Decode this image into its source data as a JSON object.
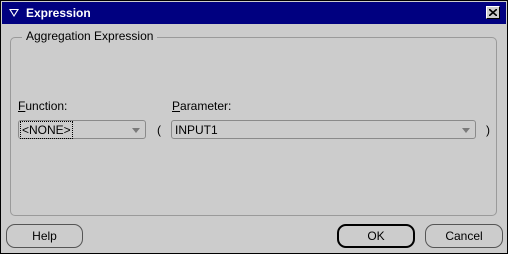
{
  "window": {
    "title": "Expression"
  },
  "group": {
    "title": "Aggregation Expression"
  },
  "function": {
    "label": "Function:",
    "value": "<NONE>"
  },
  "parameter": {
    "label": "Parameter:",
    "value": "INPUT1"
  },
  "parens": {
    "open": "(",
    "close": ")"
  },
  "buttons": {
    "help": "Help",
    "ok": "OK",
    "cancel": "Cancel"
  },
  "colors": {
    "titlebar": "#000080",
    "background": "#cccccc"
  }
}
